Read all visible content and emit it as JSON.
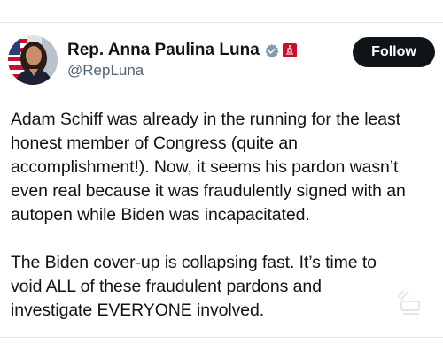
{
  "author": {
    "display_name": "Rep. Anna Paulina Luna",
    "handle": "@RepLuna",
    "verified_icon": "grey-verified-badge-icon",
    "affiliation_icon": "us-house-seal-icon"
  },
  "actions": {
    "follow_label": "Follow"
  },
  "post": {
    "paragraph_1": "Adam Schiff was already in the running for the least\nhonest member of Congress (quite an\naccomplishment!). Now, it seems his pardon wasn’t\neven real because it was fraudulently signed with an\nautopen while Biden was incapacitated.",
    "paragraph_2": "The Biden cover-up is collapsing fast. It’s time to\nvoid ALL of these fraudulent pardons and\ninvestigate EVERYONE involved."
  },
  "colors": {
    "text": "#0f1419",
    "secondary_text": "#536471",
    "follow_bg": "#0f1419",
    "verified": "#829aab",
    "affiliation": "#c8102e"
  }
}
